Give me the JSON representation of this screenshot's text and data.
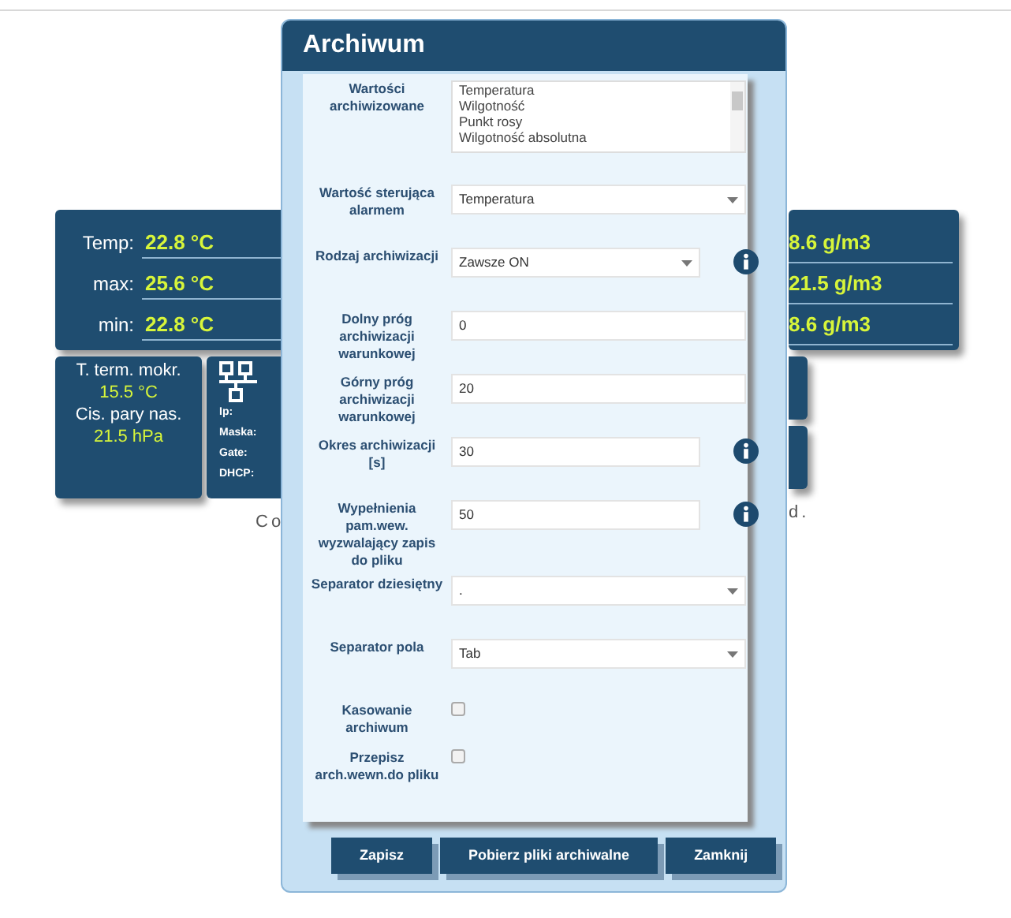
{
  "main_panel": {
    "rows": [
      {
        "label": "Temp:",
        "value": "22.8 °C"
      },
      {
        "label": "max:",
        "value": "25.6 °C"
      },
      {
        "label": "min:",
        "value": "22.8 °C"
      }
    ]
  },
  "dew_card": {
    "lines": [
      {
        "kind": "label",
        "text": "T. term. mokr."
      },
      {
        "kind": "value",
        "text": "15.5 °C"
      },
      {
        "kind": "label",
        "text": "Cis. pary nas."
      },
      {
        "kind": "value",
        "text": "21.5 hPa"
      }
    ]
  },
  "network_card": {
    "labels": [
      "Ip:",
      "Maska:",
      "Gate:",
      "DHCP:"
    ]
  },
  "right_panel": {
    "values": [
      "8.6 g/m3",
      "21.5 g/m3",
      "8.6 g/m3"
    ]
  },
  "footer": {
    "left": "Co",
    "right": "d."
  },
  "dialog": {
    "title": "Archiwum",
    "fields": [
      {
        "kind": "listbox",
        "label": "Wartości archiwizowane",
        "options": [
          "Temperatura",
          "Wilgotność",
          "Punkt rosy",
          "Wilgotność absolutna"
        ],
        "info": false
      },
      {
        "kind": "select",
        "label": "Wartość sterująca alarmem",
        "value": "Temperatura",
        "info": false
      },
      {
        "kind": "select",
        "label": "Rodzaj archiwizacji",
        "value": "Zawsze ON",
        "info": true
      },
      {
        "kind": "text",
        "label": "Dolny próg archiwizacji warunkowej",
        "value": "0",
        "info": false
      },
      {
        "kind": "text",
        "label": "Górny próg archiwizacji warunkowej",
        "value": "20",
        "info": false
      },
      {
        "kind": "text",
        "label": "Okres archiwizacji [s]",
        "value": "30",
        "info": true
      },
      {
        "kind": "text",
        "label": "Wypełnienia pam.wew. wyzwalający zapis do pliku",
        "value": "50",
        "info": true
      },
      {
        "kind": "select",
        "label": "Separator dziesiętny",
        "value": ".",
        "info": false
      },
      {
        "kind": "select",
        "label": "Separator pola",
        "value": "Tab",
        "info": false
      },
      {
        "kind": "checkbox",
        "label": "Kasowanie archiwum",
        "checked": false
      },
      {
        "kind": "checkbox",
        "label": "Przepisz arch.wewn.do pliku",
        "checked": false
      }
    ],
    "buttons": [
      "Zapisz",
      "Pobierz pliki archiwalne",
      "Zamknij"
    ]
  }
}
